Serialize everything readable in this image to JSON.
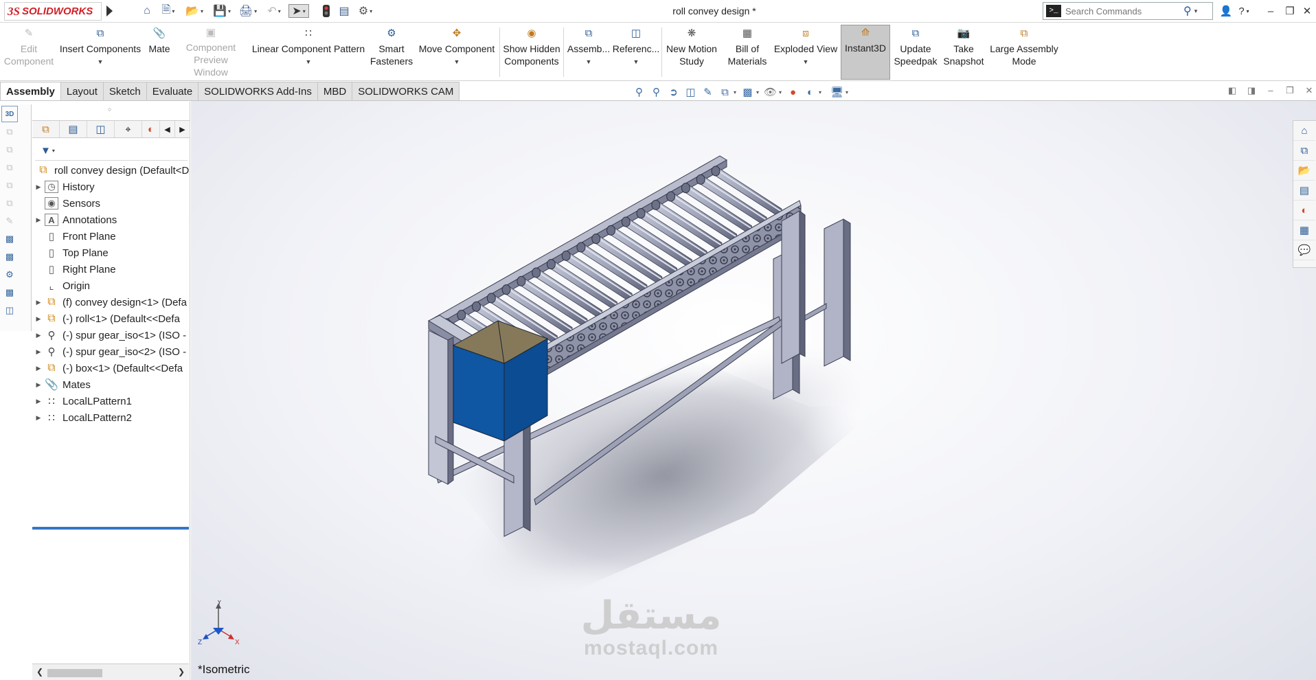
{
  "window": {
    "title": "roll convey design *",
    "brand": {
      "mark": "3S",
      "name": "SOLIDWORKS"
    }
  },
  "quick_access": [
    "home-icon",
    "new-document-icon",
    "open-folder-icon",
    "save-icon",
    "print-icon",
    "undo-icon",
    "select-arrow-icon",
    "rebuild-traffic-light-icon",
    "file-properties-icon",
    "options-gear-icon"
  ],
  "search": {
    "placeholder": "Search Commands"
  },
  "window_controls": [
    "user-icon",
    "help-icon",
    "minimize-icon",
    "restore-icon",
    "close-icon"
  ],
  "command_manager": [
    {
      "label": "Edit\nComponent",
      "enabled": false
    },
    {
      "label": "Insert Components",
      "enabled": true,
      "dropdown": true
    },
    {
      "label": "Mate",
      "enabled": true
    },
    {
      "label": "Component\nPreview Window",
      "enabled": false
    },
    {
      "label": "Linear Component Pattern",
      "enabled": true,
      "dropdown": true
    },
    {
      "label": "Smart\nFasteners",
      "enabled": true
    },
    {
      "label": "Move Component",
      "enabled": true,
      "dropdown": true
    },
    {
      "label": "Show Hidden\nComponents",
      "enabled": true
    },
    {
      "label": "Assemb...",
      "enabled": true,
      "dropdown": true
    },
    {
      "label": "Referenc...",
      "enabled": true,
      "dropdown": true
    },
    {
      "label": "New Motion\nStudy",
      "enabled": true
    },
    {
      "label": "Bill of\nMaterials",
      "enabled": true
    },
    {
      "label": "Exploded View",
      "enabled": true,
      "dropdown": true
    },
    {
      "label": "Instant3D",
      "enabled": true,
      "active": true
    },
    {
      "label": "Update\nSpeedpak",
      "enabled": true
    },
    {
      "label": "Take\nSnapshot",
      "enabled": true
    },
    {
      "label": "Large Assembly\nMode",
      "enabled": true
    }
  ],
  "tabs": [
    "Assembly",
    "Layout",
    "Sketch",
    "Evaluate",
    "SOLIDWORKS Add-Ins",
    "MBD",
    "SOLIDWORKS CAM"
  ],
  "active_tab": "Assembly",
  "feature_tree": {
    "root": "roll convey design  (Default<D",
    "items": [
      {
        "label": "History",
        "icon": "history-folder-icon",
        "expandable": true
      },
      {
        "label": "Sensors",
        "icon": "sensors-icon",
        "expandable": false
      },
      {
        "label": "Annotations",
        "icon": "annotations-icon",
        "expandable": true
      },
      {
        "label": "Front Plane",
        "icon": "plane-icon",
        "expandable": false
      },
      {
        "label": "Top Plane",
        "icon": "plane-icon",
        "expandable": false
      },
      {
        "label": "Right Plane",
        "icon": "plane-icon",
        "expandable": false
      },
      {
        "label": "Origin",
        "icon": "origin-icon",
        "expandable": false
      },
      {
        "label": "(f) convey design<1> (Defa",
        "icon": "subassembly-icon",
        "expandable": true
      },
      {
        "label": "(-) roll<1> (Default<<Defa",
        "icon": "subassembly-icon",
        "expandable": true
      },
      {
        "label": "(-) spur gear_iso<1> (ISO -",
        "icon": "toolbox-part-icon",
        "expandable": true
      },
      {
        "label": "(-) spur gear_iso<2> (ISO -",
        "icon": "toolbox-part-icon",
        "expandable": true
      },
      {
        "label": "(-) box<1> (Default<<Defa",
        "icon": "subassembly-icon",
        "expandable": true
      },
      {
        "label": "Mates",
        "icon": "mates-icon",
        "expandable": true
      },
      {
        "label": "LocalLPattern1",
        "icon": "linear-pattern-icon",
        "expandable": true
      },
      {
        "label": "LocalLPattern2",
        "icon": "linear-pattern-icon",
        "expandable": true
      }
    ]
  },
  "graphics": {
    "view_label": "*Isometric",
    "triad": {
      "y": "Y",
      "x": "X",
      "z": "Z"
    },
    "watermark": {
      "arabic": "مستقل",
      "latin": "mostaql.com"
    },
    "colors": {
      "frame": "#8d91a8",
      "roller": "#9aa0b5",
      "box_side": "#0d4f94",
      "box_top": "#8a7c5a",
      "accent": "#d21f27"
    }
  }
}
